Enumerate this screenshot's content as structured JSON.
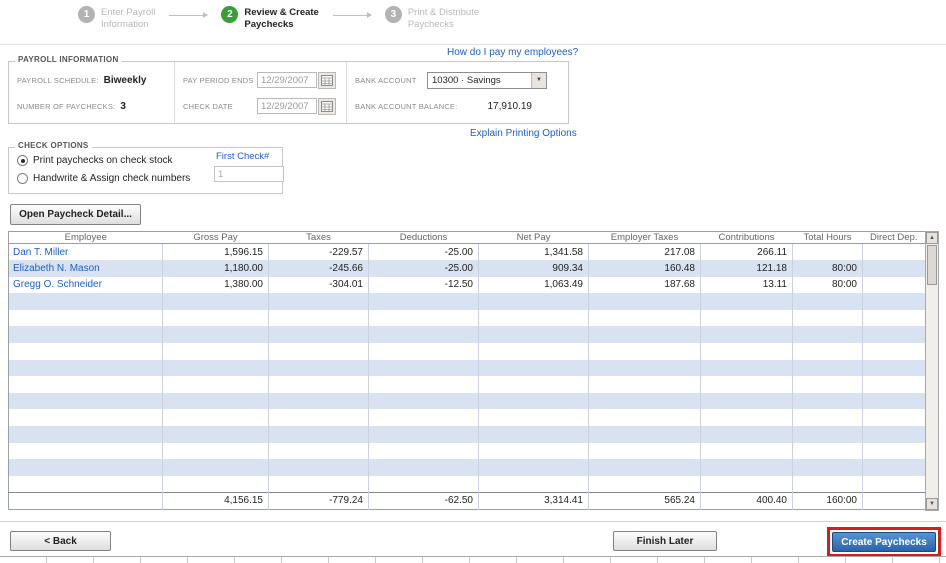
{
  "stepper": {
    "steps": [
      {
        "num": "1",
        "line1": "Enter Payroll",
        "line2": "Information"
      },
      {
        "num": "2",
        "line1": "Review & Create",
        "line2": "Paychecks"
      },
      {
        "num": "3",
        "line1": "Print & Distribute",
        "line2": "Paychecks"
      }
    ]
  },
  "links": {
    "how_do_i_pay": "How do I pay my employees?",
    "explain_printing": "Explain Printing Options"
  },
  "payroll_info": {
    "title": "PAYROLL INFORMATION",
    "schedule_label": "PAYROLL SCHEDULE:",
    "schedule_value": "Biweekly",
    "num_paychecks_label": "NUMBER OF PAYCHECKS:",
    "num_paychecks_value": "3",
    "pay_period_label": "PAY PERIOD ENDS",
    "pay_period_value": "12/29/2007",
    "check_date_label": "CHECK DATE",
    "check_date_value": "12/29/2007",
    "bank_account_label": "BANK ACCOUNT",
    "bank_account_value": "10300 · Savings",
    "bank_balance_label": "BANK ACCOUNT BALANCE:",
    "bank_balance_value": "17,910.19"
  },
  "check_options": {
    "title": "CHECK OPTIONS",
    "print_option": "Print paychecks on check stock",
    "handwrite_option": "Handwrite & Assign check numbers",
    "first_check_label": "First Check#",
    "first_check_value": "1"
  },
  "buttons": {
    "open_detail": "Open Paycheck Detail...",
    "back": "< Back",
    "finish_later": "Finish Later",
    "create": "Create Paychecks"
  },
  "table": {
    "columns": [
      "Employee",
      "Gross Pay",
      "Taxes",
      "Deductions",
      "Net Pay",
      "Employer Taxes",
      "Contributions",
      "Total Hours",
      "Direct Dep."
    ],
    "rows": [
      {
        "cells": [
          "Dan T. Miller",
          "1,596.15",
          "-229.57",
          "-25.00",
          "1,341.58",
          "217.08",
          "266.11",
          "",
          ""
        ]
      },
      {
        "cells": [
          "Elizabeth N. Mason",
          "1,180.00",
          "-245.66",
          "-25.00",
          "909.34",
          "160.48",
          "121.18",
          "80:00",
          ""
        ]
      },
      {
        "cells": [
          "Gregg O. Schneider",
          "1,380.00",
          "-304.01",
          "-12.50",
          "1,063.49",
          "187.68",
          "13.11",
          "80:00",
          ""
        ]
      }
    ],
    "totals": [
      "",
      "4,156.15",
      "-779.24",
      "-62.50",
      "3,314.41",
      "565.24",
      "400.40",
      "160:00",
      ""
    ]
  },
  "icons": {
    "scroll_up": "▲",
    "scroll_down": "▼",
    "dropdown": "▼"
  },
  "colors": {
    "accent_green": "#3a9e38",
    "link_blue": "#1f5fc4",
    "alt_row": "#d8e2f0",
    "create_button_top": "#5593d6",
    "create_button_bottom": "#2a64ab",
    "annotation_red": "#d61c1c"
  }
}
